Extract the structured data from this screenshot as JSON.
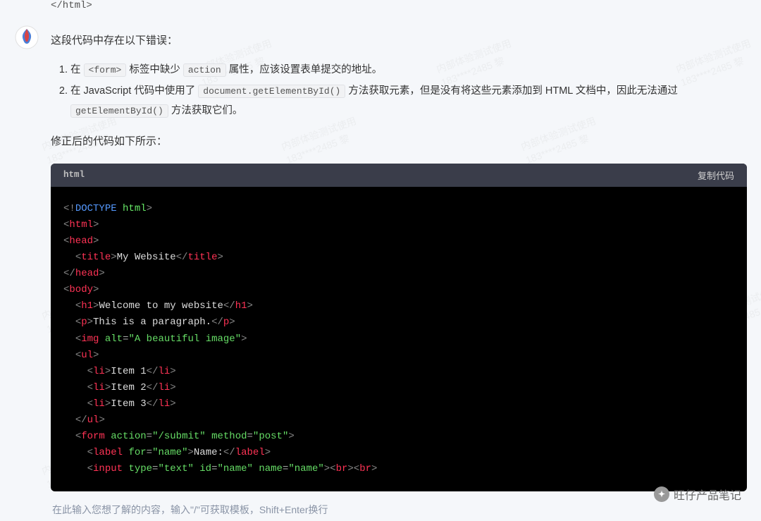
{
  "closing_tag": "</html>",
  "intro": "这段代码中存在以下错误：",
  "errors": [
    {
      "prefix": "在 ",
      "code1": "<form>",
      "mid1": " 标签中缺少 ",
      "code2": "action",
      "suffix": " 属性，应该设置表单提交的地址。"
    },
    {
      "prefix": "在 JavaScript 代码中使用了 ",
      "code1": "document.getElementById()",
      "mid1": " 方法获取元素，但是没有将这些元素添加到 HTML 文档中，因此无法通过 ",
      "code2": "getElementById()",
      "suffix": " 方法获取它们。"
    }
  ],
  "fixed_label": "修正后的代码如下所示：",
  "code": {
    "lang": "html",
    "copy_label": "复制代码",
    "lines": {
      "l1_doctype": "DOCTYPE",
      "l1_html": "html",
      "l2_html": "html",
      "l3_head": "head",
      "l4_title": "title",
      "l4_text": "My Website",
      "l5_head_close": "head",
      "l6_body": "body",
      "l7_h1": "h1",
      "l7_text": "Welcome to my website",
      "l8_p": "p",
      "l8_text": "This is a paragraph.",
      "l9_img": "img",
      "l9_alt": "alt",
      "l9_alt_val": "A beautiful image",
      "l10_ul": "ul",
      "l11_li": "li",
      "l11_text": "Item 1",
      "l12_text": "Item 2",
      "l13_text": "Item 3",
      "l14_ul_close": "ul",
      "l15_form": "form",
      "l15_action": "action",
      "l15_action_val": "/submit",
      "l15_method": "method",
      "l15_method_val": "post",
      "l16_label": "label",
      "l16_for": "for",
      "l16_for_val": "name",
      "l16_text": "Name:",
      "l17_input": "input",
      "l17_type": "type",
      "l17_type_val": "text",
      "l17_id": "id",
      "l17_id_val": "name",
      "l17_name": "name",
      "l17_name_val": "name",
      "l17_br": "br"
    }
  },
  "input_hint": "在此输入您想了解的内容，输入\"/\"可获取模板，Shift+Enter换行",
  "brand": "旺仔产品笔记",
  "watermark_line1": "内部体验测试使用",
  "watermark_line2": "183****2485 黎"
}
